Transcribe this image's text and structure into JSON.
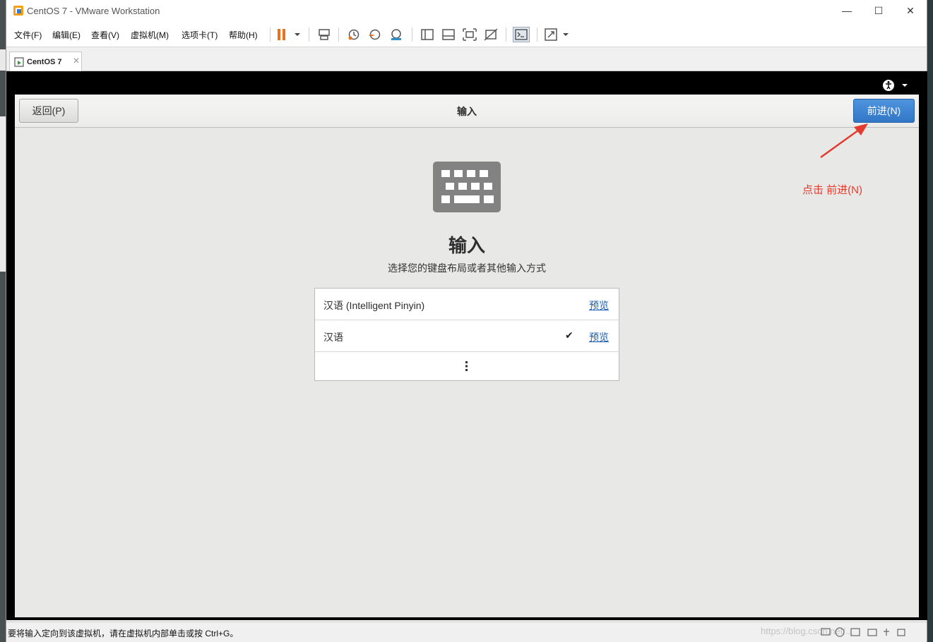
{
  "window": {
    "title": "CentOS 7 - VMware Workstation",
    "controls": {
      "minimize": "—",
      "maximize": "☐",
      "close": "✕"
    }
  },
  "menu": {
    "items": [
      "文件(F)",
      "编辑(E)",
      "查看(V)",
      "虚拟机(M)",
      "选项卡(T)",
      "帮助(H)"
    ]
  },
  "toolbar": {
    "icons": [
      "pause-icon",
      "send-ctrl-alt-del-icon",
      "snapshot-icon",
      "revert-snapshot-icon",
      "snapshot-manager-icon",
      "sidebar-view-icon",
      "thumbnail-view-icon",
      "fullscreen-icon",
      "unity-icon",
      "console-icon",
      "stretch-icon"
    ]
  },
  "tab": {
    "label": "CentOS 7",
    "close": "✕"
  },
  "installer": {
    "back_button": "返回(P)",
    "header_title": "输入",
    "next_button": "前进(N)",
    "heading": "输入",
    "subtitle": "选择您的键盘布局或者其他输入方式",
    "sources": [
      {
        "label": "汉语 (Intelligent Pinyin)",
        "selected": false,
        "preview": "预览"
      },
      {
        "label": "汉语",
        "selected": true,
        "preview": "预览",
        "check": "✔"
      }
    ]
  },
  "annotation": {
    "text": "点击 前进(N)",
    "color": "#e33b2e"
  },
  "status": {
    "message": "要将输入定向到该虚拟机，请在虚拟机内部单击或按 Ctrl+G。",
    "watermark": "https://blog.csdn.net/..."
  },
  "colors": {
    "accent": "#3a7fcf",
    "annotation": "#e33b2e",
    "pause": "#e8731c"
  }
}
